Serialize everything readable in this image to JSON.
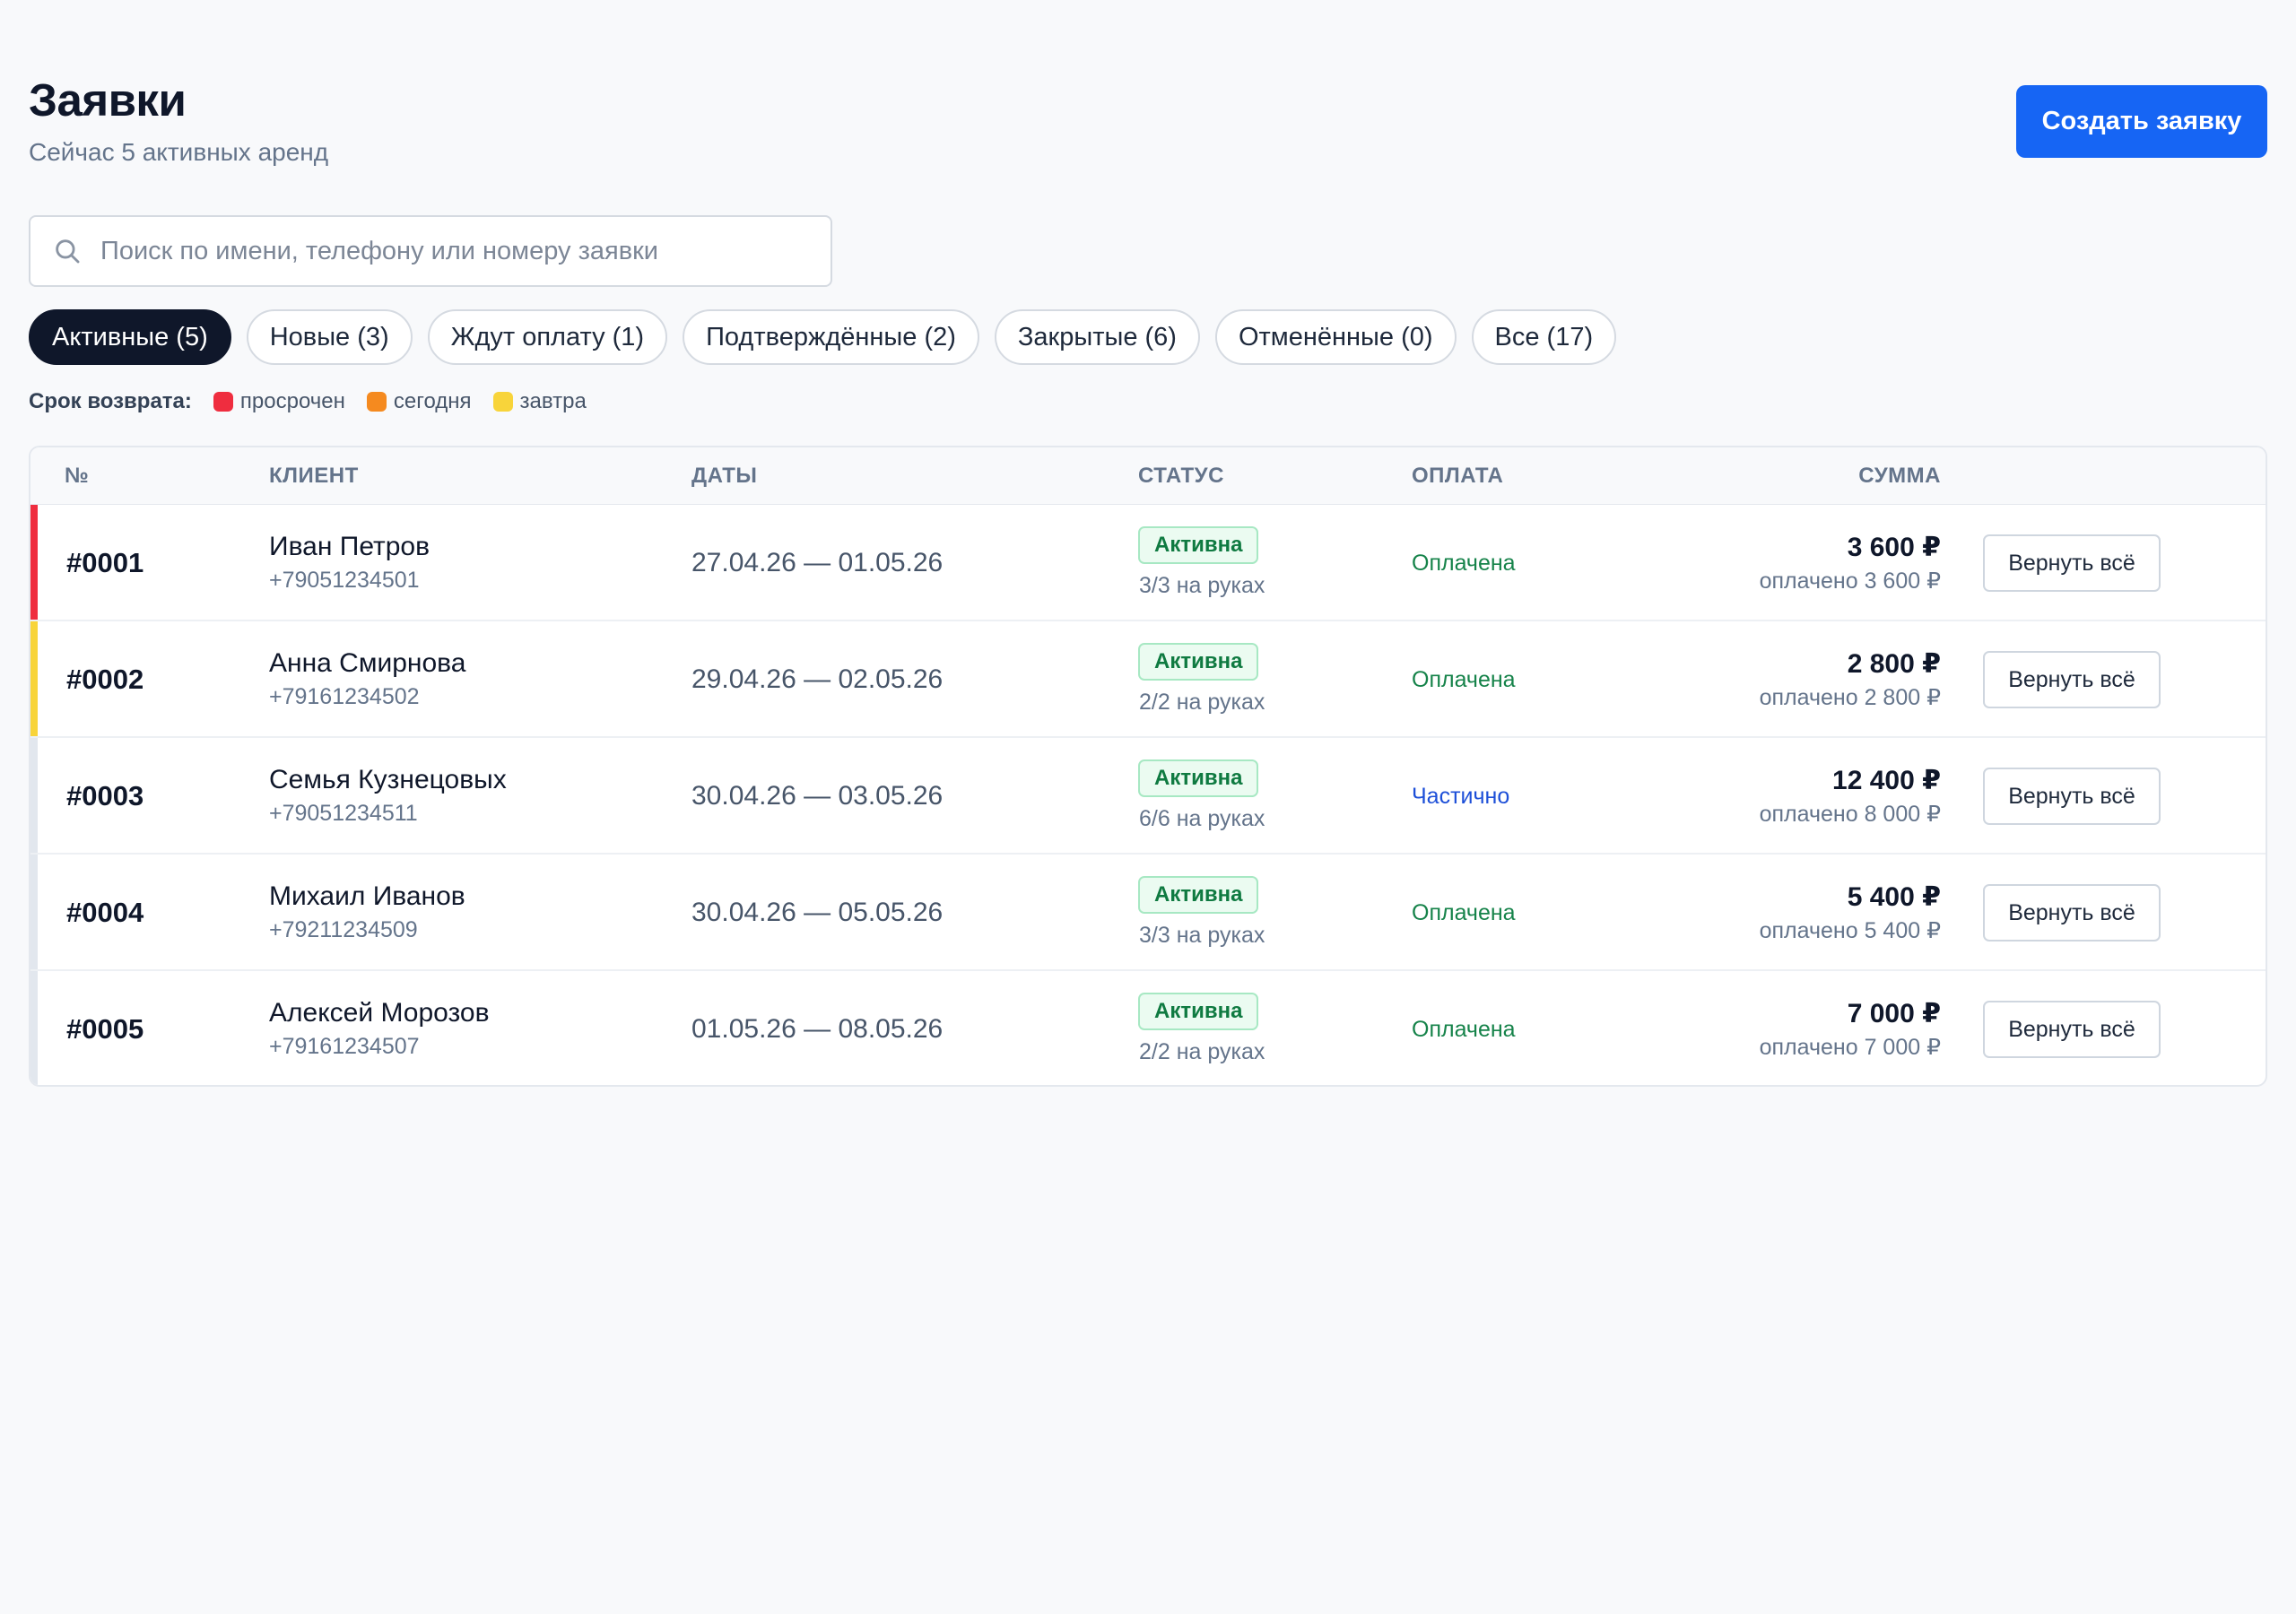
{
  "header": {
    "title": "Заявки",
    "subtitle": "Сейчас 5 активных аренд",
    "create_button": "Создать заявку"
  },
  "search": {
    "placeholder": "Поиск по имени, телефону или номеру заявки",
    "value": "",
    "icon": "search-icon"
  },
  "tabs": [
    {
      "label": "Активные (5)",
      "active": true
    },
    {
      "label": "Новые (3)",
      "active": false
    },
    {
      "label": "Ждут оплату (1)",
      "active": false
    },
    {
      "label": "Подтверждённые (2)",
      "active": false
    },
    {
      "label": "Закрытые (6)",
      "active": false
    },
    {
      "label": "Отменённые (0)",
      "active": false
    },
    {
      "label": "Все (17)",
      "active": false
    }
  ],
  "legend": {
    "title": "Срок возврата:",
    "items": [
      {
        "label": "просрочен",
        "color": "#ef2d3f"
      },
      {
        "label": "сегодня",
        "color": "#f58a1f"
      },
      {
        "label": "завтра",
        "color": "#f8d43a"
      }
    ]
  },
  "table": {
    "columns": {
      "num": "№",
      "client": "КЛИЕНТ",
      "dates": "ДАТЫ",
      "status": "СТАТУС",
      "payment": "ОПЛАТА",
      "sum": "СУММА"
    },
    "rows": [
      {
        "num": "#0001",
        "name": "Иван Петров",
        "phone": "+79051234501",
        "dates": "27.04.26 — 01.05.26",
        "status": "Активна",
        "status_sub": "3/3 на руках",
        "payment": "Оплачена",
        "payment_type": "paid",
        "sum": "3 600 ₽",
        "sum_sub": "оплачено 3 600 ₽",
        "action": "Вернуть всё",
        "marker_color": "#ef2d3f"
      },
      {
        "num": "#0002",
        "name": "Анна Смирнова",
        "phone": "+79161234502",
        "dates": "29.04.26 — 02.05.26",
        "status": "Активна",
        "status_sub": "2/2 на руках",
        "payment": "Оплачена",
        "payment_type": "paid",
        "sum": "2 800 ₽",
        "sum_sub": "оплачено 2 800 ₽",
        "action": "Вернуть всё",
        "marker_color": "#f8d43a"
      },
      {
        "num": "#0003",
        "name": "Семья Кузнецовых",
        "phone": "+79051234511",
        "dates": "30.04.26 — 03.05.26",
        "status": "Активна",
        "status_sub": "6/6 на руках",
        "payment": "Частично",
        "payment_type": "partial",
        "sum": "12 400 ₽",
        "sum_sub": "оплачено 8 000 ₽",
        "action": "Вернуть всё",
        "marker_color": "#e2e7ee"
      },
      {
        "num": "#0004",
        "name": "Михаил Иванов",
        "phone": "+79211234509",
        "dates": "30.04.26 — 05.05.26",
        "status": "Активна",
        "status_sub": "3/3 на руках",
        "payment": "Оплачена",
        "payment_type": "paid",
        "sum": "5 400 ₽",
        "sum_sub": "оплачено 5 400 ₽",
        "action": "Вернуть всё",
        "marker_color": "#e2e7ee"
      },
      {
        "num": "#0005",
        "name": "Алексей Морозов",
        "phone": "+79161234507",
        "dates": "01.05.26 — 08.05.26",
        "status": "Активна",
        "status_sub": "2/2 на руках",
        "payment": "Оплачена",
        "payment_type": "paid",
        "sum": "7 000 ₽",
        "sum_sub": "оплачено 7 000 ₽",
        "action": "Вернуть всё",
        "marker_color": "#e2e7ee"
      }
    ]
  }
}
